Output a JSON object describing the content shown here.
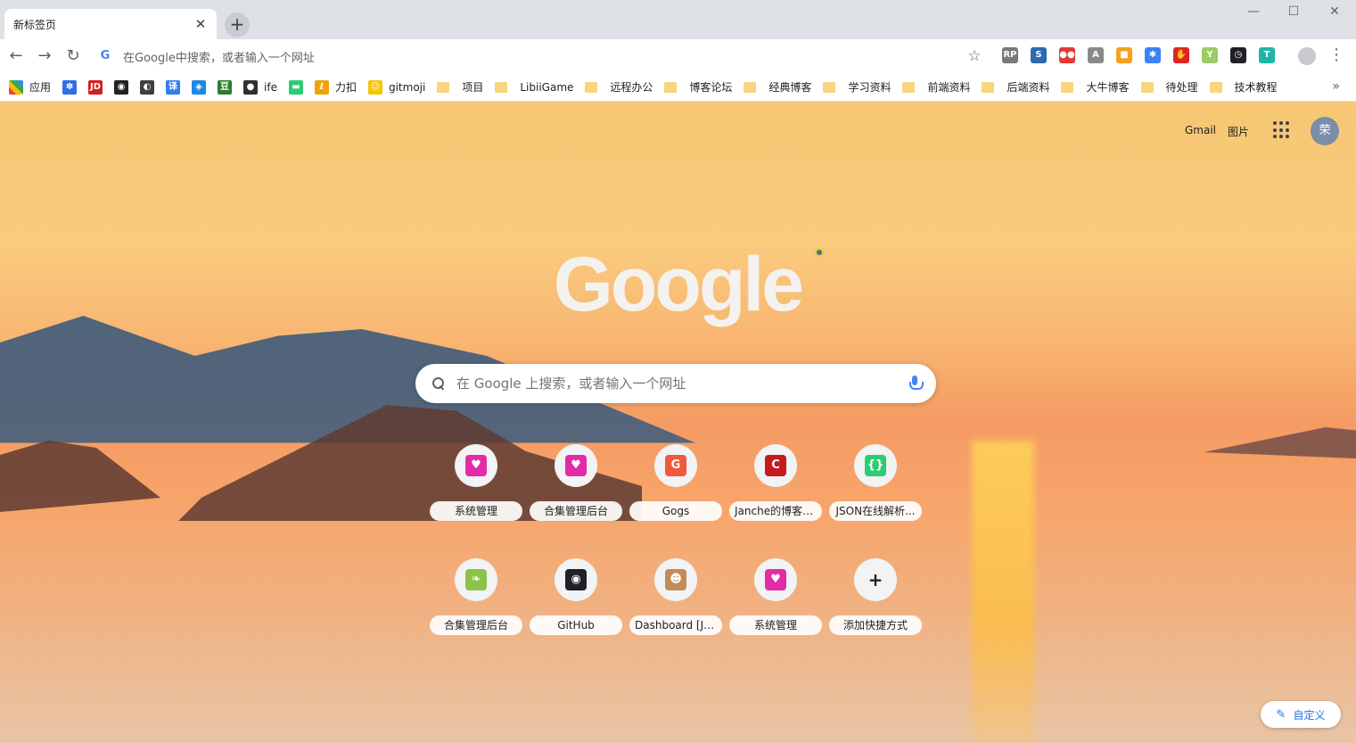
{
  "tab": {
    "title": "新标签页",
    "close_glyph": "✕"
  },
  "new_tab_glyph": "+",
  "window_controls": {
    "minimize": "—",
    "maximize": "☐",
    "close": "✕"
  },
  "toolbar": {
    "back_glyph": "←",
    "forward_glyph": "→",
    "reload_glyph": "↻",
    "omnibox_placeholder": "在Google中搜索，或者输入一个网址",
    "star_glyph": "☆",
    "menu_glyph": "⋮"
  },
  "extensions": [
    {
      "name": "axure-rp-icon",
      "glyph": "RP",
      "color": "#7a7a7a"
    },
    {
      "name": "screen-capture-icon",
      "glyph": "S",
      "color": "#2b6cb0"
    },
    {
      "name": "flickr-icon",
      "glyph": "●●",
      "color": "#e53935"
    },
    {
      "name": "pdf-icon",
      "glyph": "A",
      "color": "#8a8a8a"
    },
    {
      "name": "color-grid-icon",
      "glyph": "■",
      "color": "#f4a020"
    },
    {
      "name": "pinwheel-icon",
      "glyph": "✱",
      "color": "#3b82f6"
    },
    {
      "name": "stop-icon",
      "glyph": "✋",
      "color": "#e02424"
    },
    {
      "name": "y-icon",
      "glyph": "Y",
      "color": "#9ccc65"
    },
    {
      "name": "clock-icon",
      "glyph": "◷",
      "color": "#202124"
    },
    {
      "name": "translate-icon",
      "glyph": "T",
      "color": "#1fb5a8"
    }
  ],
  "bookmarks": {
    "apps_label": "应用",
    "sites": [
      {
        "name": "baidu",
        "glyph": "✽",
        "color": "#2f6fe4",
        "label": ""
      },
      {
        "name": "jd",
        "glyph": "JD",
        "color": "#d71c1e",
        "label": ""
      },
      {
        "name": "github",
        "glyph": "◉",
        "color": "#202124",
        "label": ""
      },
      {
        "name": "bilibili",
        "glyph": "◐",
        "color": "#3c4043",
        "label": ""
      },
      {
        "name": "translate",
        "glyph": "译",
        "color": "#2f80ed",
        "label": ""
      },
      {
        "name": "cube",
        "glyph": "◈",
        "color": "#1e88e5",
        "label": ""
      },
      {
        "name": "douban",
        "glyph": "豆",
        "color": "#2e7d32",
        "label": ""
      },
      {
        "name": "ife",
        "glyph": "●",
        "color": "#303030",
        "label": "ife"
      },
      {
        "name": "json",
        "glyph": "▬",
        "color": "#2ecc71",
        "label": ""
      },
      {
        "name": "leetcode",
        "glyph": "ℓ",
        "color": "#f1a30c",
        "label": "力扣"
      },
      {
        "name": "gitmoji",
        "glyph": "☺",
        "color": "#f7c600",
        "label": "gitmoji"
      }
    ],
    "folders": [
      "项目",
      "LibiiGame",
      "远程办公",
      "博客论坛",
      "经典博客",
      "学习资料",
      "前端资料",
      "后端资料",
      "大牛博客",
      "待处理",
      "技术教程"
    ],
    "more_glyph": "»"
  },
  "header_links": {
    "gmail": "Gmail",
    "images": "图片",
    "avatar_initial": "荣"
  },
  "logo_text": "Google",
  "search": {
    "placeholder": "在 Google 上搜索，或者输入一个网址"
  },
  "shortcuts": [
    {
      "name": "shortcut-system-admin-1",
      "label": "系统管理",
      "glyph": "♥",
      "color": "#e22ba7"
    },
    {
      "name": "shortcut-collection-admin-1",
      "label": "合集管理后台",
      "glyph": "♥",
      "color": "#e22ba7"
    },
    {
      "name": "shortcut-gogs",
      "label": "Gogs",
      "glyph": "G",
      "color": "#f05a3a"
    },
    {
      "name": "shortcut-janche-blog",
      "label": "Janche的博客_...",
      "glyph": "C",
      "color": "#c71a1a"
    },
    {
      "name": "shortcut-json-parser",
      "label": "JSON在线解析...",
      "glyph": "{}",
      "color": "#2ecc71"
    },
    {
      "name": "shortcut-collection-admin-2",
      "label": "合集管理后台",
      "glyph": "❧",
      "color": "#8bc34a"
    },
    {
      "name": "shortcut-github",
      "label": "GitHub",
      "glyph": "◉",
      "color": "#202124"
    },
    {
      "name": "shortcut-jenkins-dashboard",
      "label": "Dashboard [Je...",
      "glyph": "☻",
      "color": "#c48a5a"
    },
    {
      "name": "shortcut-system-admin-2",
      "label": "系统管理",
      "glyph": "♥",
      "color": "#e22ba7"
    },
    {
      "name": "shortcut-add",
      "label": "添加快捷方式",
      "glyph": "+",
      "color": "#f1f3f4"
    }
  ],
  "customize": {
    "label": "自定义",
    "glyph": "✎"
  }
}
